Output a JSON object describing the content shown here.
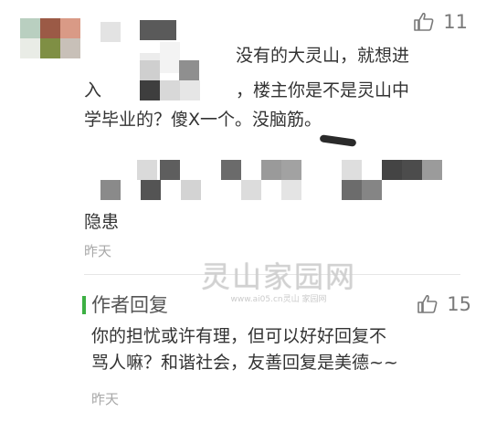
{
  "comment": {
    "line1_visible": "没有的大灵山，就想进",
    "line2_start": "入",
    "line2_mid": "，楼主你是不是灵山中",
    "line3": "学毕业的？傻X一个。没脑筋。",
    "line6": "隐患",
    "timestamp": "昨天",
    "likes": "11"
  },
  "reply": {
    "header": "作者回复",
    "line1": "你的担忧或许有理，但可以好好回复不",
    "line2": "骂人嘛？和谐社会，友善回复是美德~~",
    "timestamp": "昨天",
    "likes": "15"
  },
  "watermark": {
    "main": "灵山家园网",
    "sub": "www.ai05.cn灵山 家园网"
  },
  "colors": {
    "reply_accent": "#3cb043",
    "timestamp": "#a8a8a8",
    "icon": "#7a7a7a"
  },
  "icons": {
    "like": "thumbs-up-icon"
  }
}
